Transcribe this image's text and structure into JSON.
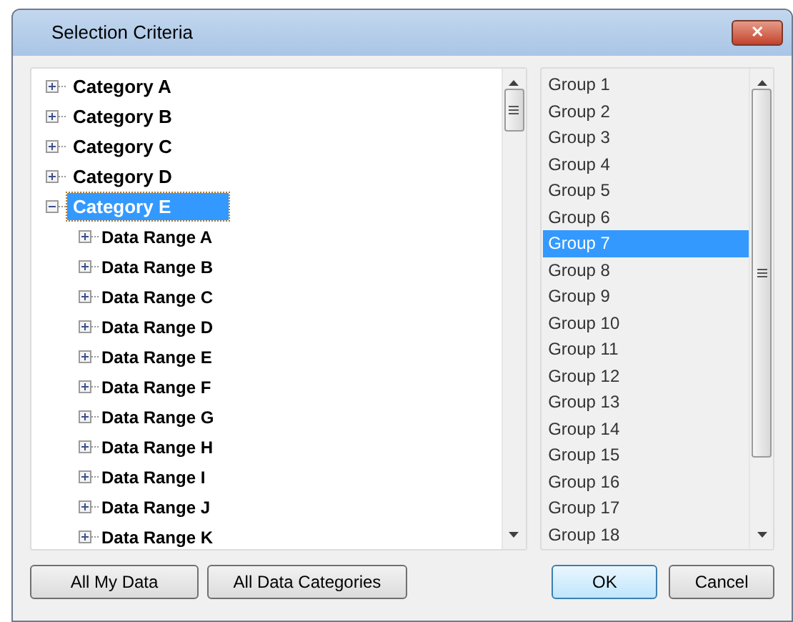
{
  "window": {
    "title": "Selection Criteria",
    "close": "✕"
  },
  "tree": [
    {
      "label": "Category A",
      "expanded": false,
      "selected": false
    },
    {
      "label": "Category B",
      "expanded": false,
      "selected": false
    },
    {
      "label": "Category C",
      "expanded": false,
      "selected": false
    },
    {
      "label": "Category D",
      "expanded": false,
      "selected": false
    },
    {
      "label": "Category E",
      "expanded": true,
      "selected": true,
      "children": [
        {
          "label": "Data Range A",
          "expanded": false,
          "selected": false
        },
        {
          "label": "Data Range B",
          "expanded": false,
          "selected": false
        },
        {
          "label": "Data Range C",
          "expanded": false,
          "selected": false
        },
        {
          "label": "Data Range D",
          "expanded": false,
          "selected": false
        },
        {
          "label": "Data Range E",
          "expanded": false,
          "selected": false
        },
        {
          "label": "Data Range F",
          "expanded": false,
          "selected": false
        },
        {
          "label": "Data Range G",
          "expanded": false,
          "selected": false
        },
        {
          "label": "Data Range H",
          "expanded": false,
          "selected": false
        },
        {
          "label": "Data Range I",
          "expanded": false,
          "selected": false
        },
        {
          "label": "Data Range J",
          "expanded": false,
          "selected": false
        },
        {
          "label": "Data Range K",
          "expanded": false,
          "selected": false
        }
      ]
    }
  ],
  "groups": [
    {
      "label": "Group 1",
      "selected": false
    },
    {
      "label": "Group 2",
      "selected": false
    },
    {
      "label": "Group 3",
      "selected": false
    },
    {
      "label": "Group 4",
      "selected": false
    },
    {
      "label": "Group 5",
      "selected": false
    },
    {
      "label": "Group 6",
      "selected": false
    },
    {
      "label": "Group 7",
      "selected": true
    },
    {
      "label": "Group 8",
      "selected": false
    },
    {
      "label": "Group 9",
      "selected": false
    },
    {
      "label": "Group 10",
      "selected": false
    },
    {
      "label": "Group 11",
      "selected": false
    },
    {
      "label": "Group 12",
      "selected": false
    },
    {
      "label": "Group 13",
      "selected": false
    },
    {
      "label": "Group 14",
      "selected": false
    },
    {
      "label": "Group 15",
      "selected": false
    },
    {
      "label": "Group 16",
      "selected": false
    },
    {
      "label": "Group 17",
      "selected": false
    },
    {
      "label": "Group 18",
      "selected": false
    }
  ],
  "buttons": {
    "left": [
      "All My Data",
      "All Data Categories"
    ],
    "ok": "OK",
    "cancel": "Cancel"
  }
}
